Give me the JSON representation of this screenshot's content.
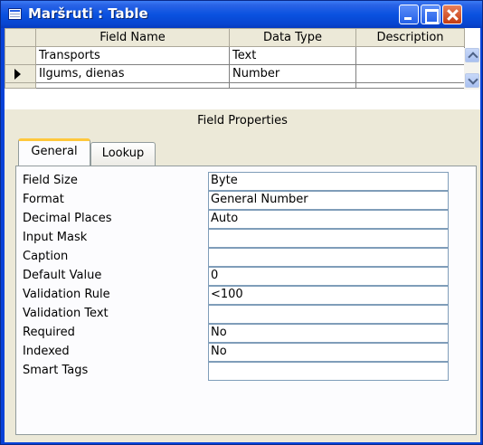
{
  "window": {
    "title": "Maršruti : Table"
  },
  "grid": {
    "columns": [
      "Field Name",
      "Data Type",
      "Description"
    ],
    "rows": [
      {
        "field_name": "Transports",
        "data_type": "Text",
        "description": ""
      },
      {
        "field_name": "Ilgums, dienas",
        "data_type": "Number",
        "description": ""
      }
    ]
  },
  "field_properties": {
    "header": "Field Properties",
    "tabs": [
      {
        "label": "General",
        "active": true
      },
      {
        "label": "Lookup",
        "active": false
      }
    ],
    "properties": [
      {
        "label": "Field Size",
        "value": "Byte"
      },
      {
        "label": "Format",
        "value": "General Number"
      },
      {
        "label": "Decimal Places",
        "value": "Auto"
      },
      {
        "label": "Input Mask",
        "value": ""
      },
      {
        "label": "Caption",
        "value": ""
      },
      {
        "label": "Default Value",
        "value": "0"
      },
      {
        "label": "Validation Rule",
        "value": "<100"
      },
      {
        "label": "Validation Text",
        "value": ""
      },
      {
        "label": "Required",
        "value": "No"
      },
      {
        "label": "Indexed",
        "value": "No"
      },
      {
        "label": "Smart Tags",
        "value": ""
      }
    ]
  },
  "colors": {
    "titlebar": "#0a52e0",
    "active_tab_accent": "#ffc83c",
    "panel_bg": "#ece9d8"
  }
}
